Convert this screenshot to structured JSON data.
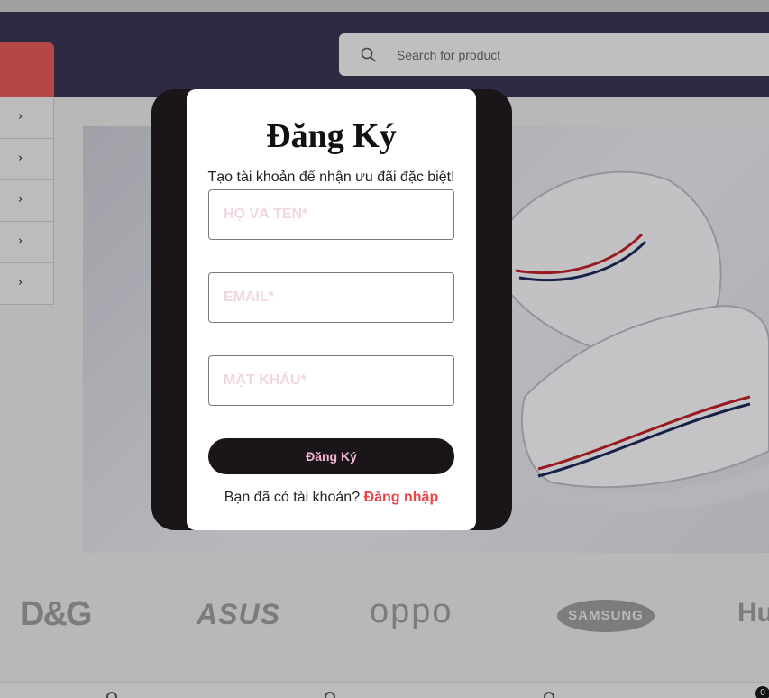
{
  "search": {
    "placeholder": "Search for product"
  },
  "sidebar": {
    "items": [
      {
        "icon": "chevron-right-icon"
      },
      {
        "icon": "chevron-right-icon"
      },
      {
        "icon": "chevron-right-icon"
      },
      {
        "icon": "chevron-right-icon"
      },
      {
        "icon": "chevron-right-icon"
      }
    ]
  },
  "brands": [
    "D&G",
    "ASUS",
    "oppo",
    "SAMSUNG",
    "Hu"
  ],
  "cart": {
    "count": "0"
  },
  "modal": {
    "title": "Đăng Ký",
    "subtitle": "Tạo tài khoản để nhận ưu đãi đặc biệt!",
    "name_placeholder": "HỌ VÀ TÊN*",
    "email_placeholder": "EMAIL*",
    "password_placeholder": "MẬT KHẨU*",
    "submit_label": "Đăng Ký",
    "have_account_text": "Bạn đã có tài khoản?",
    "login_link": "Đăng nhập"
  },
  "colors": {
    "header": "#3a3552",
    "accent": "#e25a5a",
    "modal_dark": "#1a1518",
    "button_text": "#f4b8d4",
    "link": "#e8474a"
  }
}
